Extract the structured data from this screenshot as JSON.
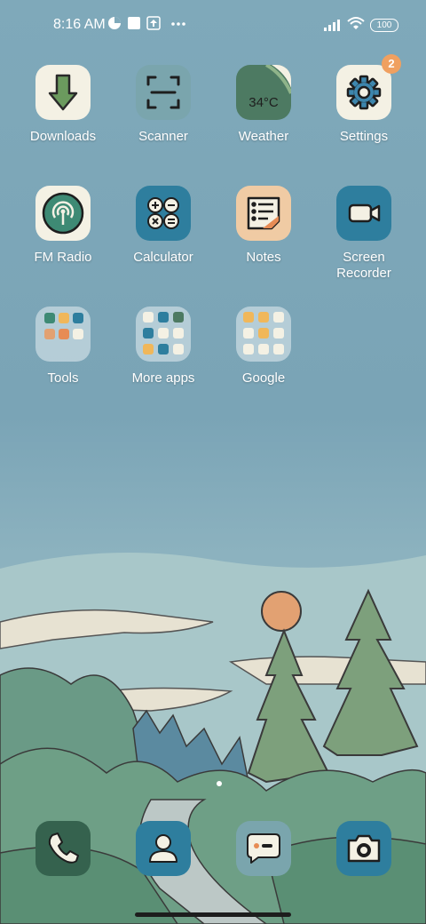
{
  "status_bar": {
    "time": "8:16 AM",
    "battery": "100",
    "notification_icons": [
      "data-saver-icon",
      "square-notification-icon",
      "upload-icon",
      "more-dots-icon"
    ],
    "system_icons": [
      "cellular-signal-icon",
      "wifi-icon",
      "battery-icon"
    ]
  },
  "apps": {
    "downloads": {
      "label": "Downloads"
    },
    "scanner": {
      "label": "Scanner"
    },
    "weather": {
      "label": "Weather",
      "temp": "34°C"
    },
    "settings": {
      "label": "Settings",
      "badge": "2"
    },
    "fm_radio": {
      "label": "FM Radio"
    },
    "calculator": {
      "label": "Calculator"
    },
    "notes": {
      "label": "Notes"
    },
    "screen_recorder": {
      "label": "Screen\nRecorder"
    },
    "tools": {
      "label": "Tools"
    },
    "more_apps": {
      "label": "More apps"
    },
    "google": {
      "label": "Google"
    }
  },
  "dock": [
    "phone-icon",
    "contacts-icon",
    "messages-icon",
    "camera-icon"
  ],
  "colors": {
    "accent_orange": "#f0a060",
    "teal_dark": "#2e7e9e",
    "green_dark": "#35624e",
    "cream": "#f4f1e4"
  }
}
